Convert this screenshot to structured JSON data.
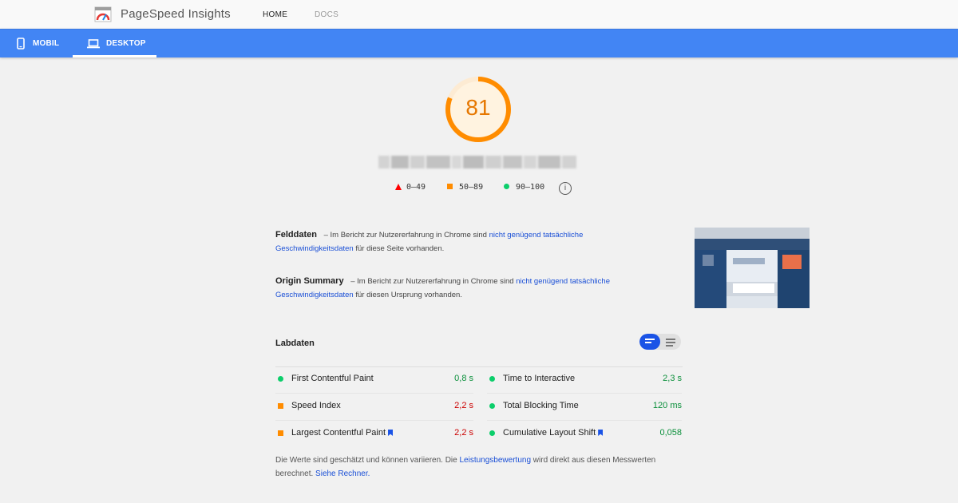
{
  "app": {
    "title": "PageSpeed Insights"
  },
  "nav": {
    "home": "HOME",
    "docs": "DOCS"
  },
  "tabs": [
    {
      "label": "MOBIL",
      "icon": "smartphone-icon",
      "active": false
    },
    {
      "label": "DESKTOP",
      "icon": "laptop-icon",
      "active": true
    }
  ],
  "score": {
    "value": "81",
    "fraction": 0.81,
    "color": "#ff8c00"
  },
  "legend": {
    "poor": "0–49",
    "average": "50–89",
    "good": "90–100",
    "info_icon": "i"
  },
  "field_data": {
    "title": "Felddaten",
    "text_before": "– Im Bericht zur Nutzererfahrung in Chrome sind",
    "link": "nicht genügend tatsächliche Geschwindigkeitsdaten",
    "text_after": "für diese Seite vorhanden."
  },
  "origin_summary": {
    "title": "Origin Summary",
    "text_before": "– Im Bericht zur Nutzererfahrung in Chrome sind",
    "link": "nicht genügend tatsächliche Geschwindigkeitsdaten",
    "text_after": "für diesen Ursprung vorhanden."
  },
  "lab_data": {
    "title": "Labdaten",
    "metrics_left": [
      {
        "label": "First Contentful Paint",
        "value": "0,8 s",
        "status": "good",
        "bookmark": false
      },
      {
        "label": "Speed Index",
        "value": "2,2 s",
        "status": "average",
        "bookmark": false
      },
      {
        "label": "Largest Contentful Paint",
        "value": "2,2 s",
        "status": "average",
        "bookmark": true
      }
    ],
    "metrics_right": [
      {
        "label": "Time to Interactive",
        "value": "2,3 s",
        "status": "good",
        "bookmark": false
      },
      {
        "label": "Total Blocking Time",
        "value": "120 ms",
        "status": "good",
        "bookmark": false
      },
      {
        "label": "Cumulative Layout Shift",
        "value": "0,058",
        "status": "good",
        "bookmark": true
      }
    ]
  },
  "footnote": {
    "text1": "Die Werte sind geschätzt und können variieren. Die",
    "link1": "Leistungsbewertung",
    "text2": "wird direkt aus diesen Messwerten berechnet.",
    "link2": "Siehe Rechner."
  },
  "colors": {
    "accent_blue": "#4285f4",
    "good": "#0cce6b",
    "average": "#ff8c00",
    "poor": "#ff0000"
  }
}
